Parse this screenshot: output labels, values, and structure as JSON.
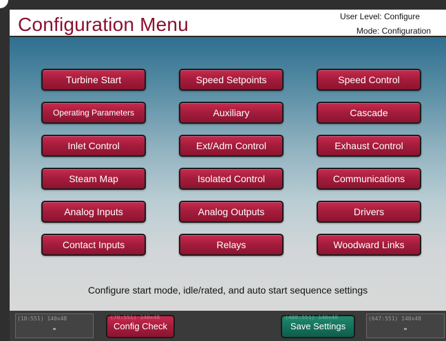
{
  "header": {
    "title": "Configuration Menu",
    "user_level": "User Level: Configure",
    "mode": "Mode: Configuration"
  },
  "menu": {
    "rows": [
      [
        "Turbine Start",
        "Speed Setpoints",
        "Speed Control"
      ],
      [
        "Operating Parameters",
        "Auxiliary",
        "Cascade"
      ],
      [
        "Inlet Control",
        "Ext/Adm Control",
        "Exhaust Control"
      ],
      [
        "Steam Map",
        "Isolated Control",
        "Communications"
      ],
      [
        "Analog Inputs",
        "Analog Outputs",
        "Drivers"
      ],
      [
        "Contact Inputs",
        "Relays",
        "Woodward Links"
      ]
    ]
  },
  "description": "Configure start mode, idle/rated, and auto start sequence settings",
  "footer": {
    "slot_left_label": "(10:551) 140x48",
    "slot_right_label": "(647:551) 140x48",
    "config_check_overlay": "(70:551) 140x48",
    "save_settings_overlay": "(488:551) 140x48",
    "config_check_label": "Config Check",
    "save_settings_label": "Save Settings"
  },
  "colors": {
    "title": "#8b1030",
    "button": "#a61d3c",
    "save_button": "#16725c"
  }
}
